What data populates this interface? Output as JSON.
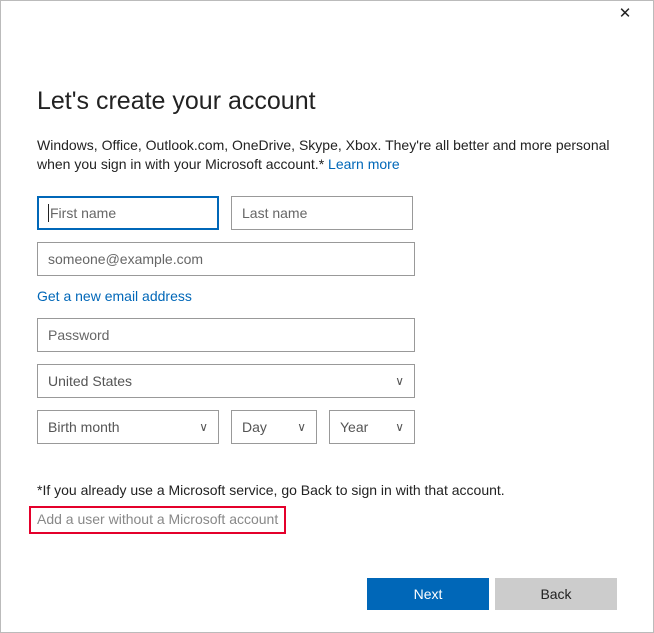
{
  "heading": "Let's create your account",
  "description_pre": "Windows, Office, Outlook.com, OneDrive, Skype, Xbox. They're all better and more personal when you sign in with your Microsoft account.* ",
  "learn_more": "Learn more",
  "fields": {
    "first_name_placeholder": "First name",
    "last_name_placeholder": "Last name",
    "email_placeholder": "someone@example.com",
    "password_placeholder": "Password"
  },
  "get_new_email": "Get a new email address",
  "selects": {
    "country": "United States",
    "birth_month": "Birth month",
    "birth_day": "Day",
    "birth_year": "Year"
  },
  "footnote": "*If you already use a Microsoft service, go Back to sign in with that account.",
  "add_user_without": "Add a user without a Microsoft account",
  "buttons": {
    "next": "Next",
    "back": "Back"
  },
  "close_glyph": "✕"
}
